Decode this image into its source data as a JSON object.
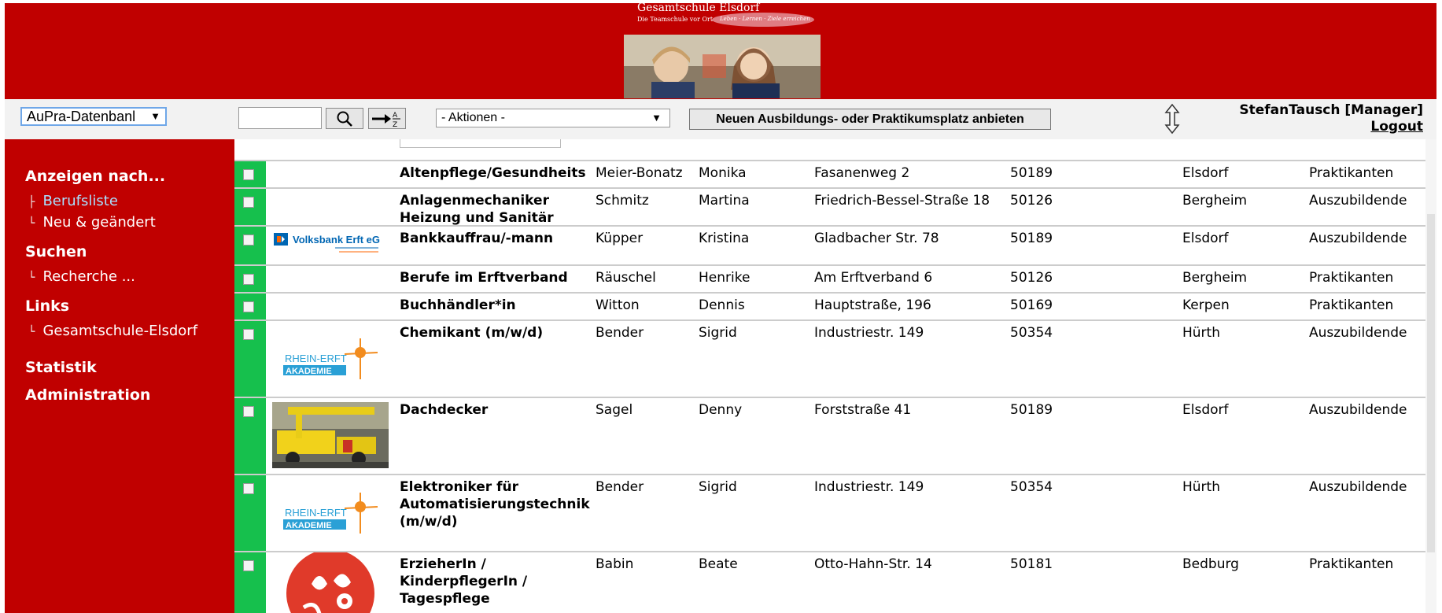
{
  "header": {
    "school_name": "Gesamtschule Elsdorf",
    "school_tagline": "Die Teamschule vor Ort",
    "school_motto": "Leben · Lernen · Ziele erreichen"
  },
  "toolbar": {
    "database_select": "AuPra-Datenbanl",
    "search_value": "",
    "actions_select": "- Aktionen -",
    "offer_button": "Neuen Ausbildungs- oder Praktikumsplatz anbieten",
    "user_name": "StefanTausch  [Manager]",
    "logout": "Logout"
  },
  "sidebar": {
    "sections": [
      {
        "title": "Anzeigen nach...",
        "items": [
          "Berufsliste",
          "Neu & geändert"
        ]
      },
      {
        "title": "Suchen",
        "items": [
          "Recherche ..."
        ]
      },
      {
        "title": "Links",
        "items": [
          "Gesamtschule-Elsdorf"
        ]
      },
      {
        "title": "Statistik",
        "items": []
      },
      {
        "title": "Administration",
        "items": []
      }
    ],
    "active_item": "Berufsliste"
  },
  "table": {
    "rows": [
      {
        "job": "Altenpflege/Gesundheits",
        "last": "Meier-Bonatz",
        "first": "Monika",
        "street": "Fasanenweg 2",
        "zip": "50189",
        "city": "Elsdorf",
        "type": "Praktikanten",
        "logo": ""
      },
      {
        "job": "Anlagenmechaniker Heizung und Sanitär",
        "last": "Schmitz",
        "first": "Martina",
        "street": "Friedrich-Bessel-Straße 18",
        "zip": "50126",
        "city": "Bergheim",
        "type": "Auszubildende",
        "logo": ""
      },
      {
        "job": "Bankkauffrau/-mann",
        "last": "Küpper",
        "first": "Kristina",
        "street": "Gladbacher Str. 78",
        "zip": "50189",
        "city": "Elsdorf",
        "type": "Auszubildende",
        "logo": "volksbank",
        "logo_text": "Volksbank Erft eG"
      },
      {
        "job": "Berufe im Erftverband",
        "last": "Räuschel",
        "first": "Henrike",
        "street": "Am Erftverband 6",
        "zip": "50126",
        "city": "Bergheim",
        "type": "Praktikanten",
        "logo": ""
      },
      {
        "job": "Buchhändler*in",
        "last": "Witton",
        "first": "Dennis",
        "street": "Hauptstraße, 196",
        "zip": "50169",
        "city": "Kerpen",
        "type": "Praktikanten",
        "logo": ""
      },
      {
        "job": "Chemikant (m/w/d)",
        "last": "Bender",
        "first": "Sigrid",
        "street": "Industriestr. 149",
        "zip": "50354",
        "city": "Hürth",
        "type": "Auszubildende",
        "logo": "rhein-erft",
        "logo_text_1": "RHEIN-ERFT",
        "logo_text_2": "AKADEMIE"
      },
      {
        "job": "Dachdecker",
        "last": "Sagel",
        "first": "Denny",
        "street": "Forststraße 41",
        "zip": "50189",
        "city": "Elsdorf",
        "type": "Auszubildende",
        "logo": "truck-photo"
      },
      {
        "job": "Elektroniker für Automatisierungstechnik (m/w/d)",
        "last": "Bender",
        "first": "Sigrid",
        "street": "Industriestr. 149",
        "zip": "50354",
        "city": "Hürth",
        "type": "Auszubildende",
        "logo": "rhein-erft",
        "logo_text_1": "RHEIN-ERFT",
        "logo_text_2": "AKADEMIE"
      },
      {
        "job": "ErzieherIn / KinderpflegerIn / Tagespflege",
        "last": "Babin",
        "first": "Beate",
        "street": "Otto-Hahn-Str. 14",
        "zip": "50181",
        "city": "Bedburg",
        "type": "Praktikanten",
        "logo": "red-circle"
      }
    ]
  },
  "colors": {
    "brand_red": "#c00000",
    "row_check_green": "#16c04d",
    "active_nav": "#a8e0ff"
  }
}
